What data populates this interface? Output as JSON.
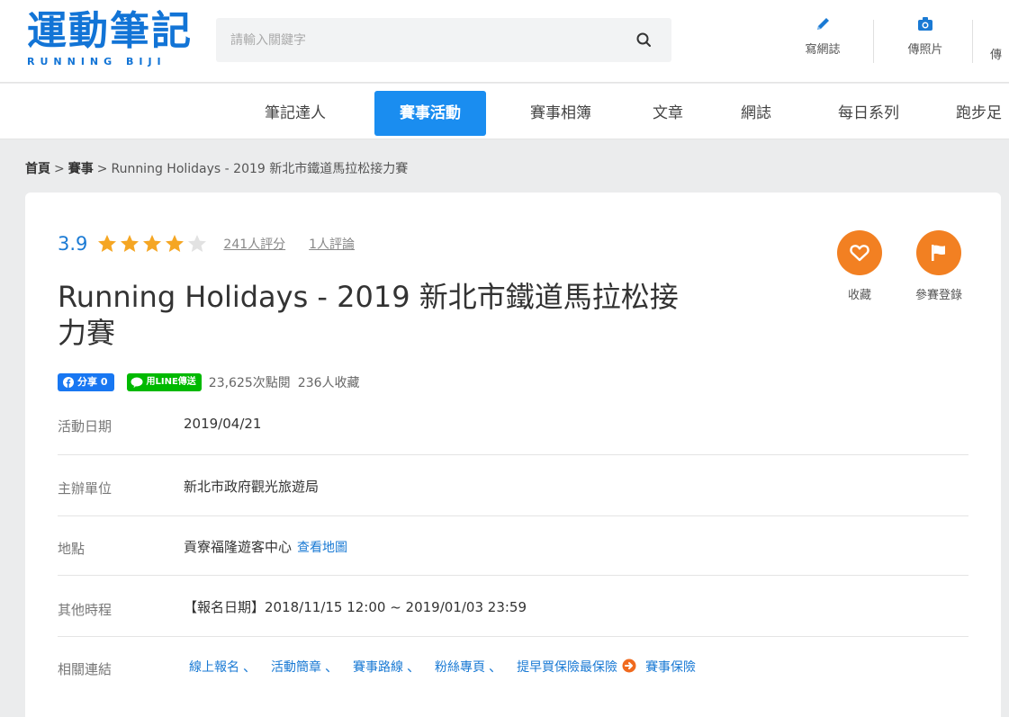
{
  "logo": {
    "main": "運動筆記",
    "sub": "RUNNING  BIJI"
  },
  "search": {
    "placeholder": "請輸入關鍵字"
  },
  "header_actions": [
    {
      "label": "寫網誌",
      "icon": "pencil-icon"
    },
    {
      "label": "傳照片",
      "icon": "camera-icon"
    },
    {
      "label": "傳",
      "icon": "upload-icon"
    }
  ],
  "nav": [
    {
      "label": "筆記達人"
    },
    {
      "label": "賽事活動",
      "active": true
    },
    {
      "label": "賽事相簿"
    },
    {
      "label": "文章"
    },
    {
      "label": "網誌"
    },
    {
      "label": "每日系列"
    },
    {
      "label": "跑步足"
    }
  ],
  "breadcrumb": {
    "home": "首頁",
    "sep": ">",
    "section": "賽事",
    "current": "Running Holidays - 2019 新北市鐵道馬拉松接力賽"
  },
  "event": {
    "rating": 3.9,
    "rating_text": "3.9",
    "stars_full": 4,
    "stars_total": 5,
    "ratings_count": "241人評分",
    "reviews_count": "1人評論",
    "title": "Running Holidays - 2019 新北市鐵道馬拉松接力賽",
    "fb_share": "分享 0",
    "line_share": "用LINE傳送",
    "views": "23,625次點閱",
    "favorites": "236人收藏",
    "fav_label": "收藏",
    "register_label": "參賽登錄"
  },
  "info": {
    "date_label": "活動日期",
    "date_value": "2019/04/21",
    "org_label": "主辦單位",
    "org_value": "新北市政府觀光旅遊局",
    "loc_label": "地點",
    "loc_value": "貢寮福隆遊客中心",
    "map_link": "查看地圖",
    "sched_label": "其他時程",
    "sched_value": "【報名日期】2018/11/15 12:00 ~ 2019/01/03 23:59",
    "links_label": "相關連結",
    "links": [
      "線上報名",
      "活動簡章",
      "賽事路線",
      "粉絲專頁"
    ],
    "link_sep": "、",
    "insurance_promo": "提早買保險最保險",
    "insurance_link": "賽事保險"
  },
  "colors": {
    "brand": "#1274d6",
    "accent": "#f28022",
    "nav_active": "#1a8df0",
    "star": "#f5a623"
  }
}
